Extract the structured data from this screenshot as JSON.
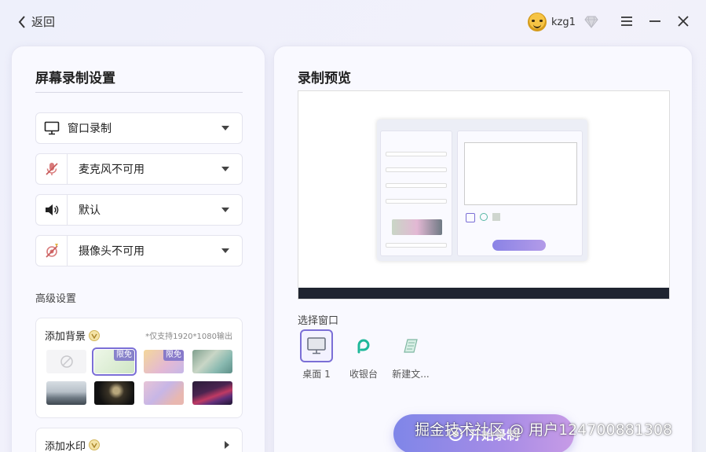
{
  "header": {
    "back_label": "返回",
    "username": "kzg1"
  },
  "left": {
    "title": "屏幕录制设置",
    "selects": [
      {
        "label": "窗口录制",
        "icon": "monitor-icon"
      },
      {
        "label": "麦克风不可用",
        "icon": "mic-off-icon"
      },
      {
        "label": "默认",
        "icon": "speaker-icon"
      },
      {
        "label": "摄像头不可用",
        "icon": "camera-off-icon"
      }
    ],
    "advanced_label": "高级设置",
    "background": {
      "title": "添加背景",
      "note": "*仅支持1920*1080输出",
      "badges": [
        "限免",
        "限免"
      ]
    },
    "watermark_label": "添加水印"
  },
  "right": {
    "title": "录制预览",
    "choose_label": "选择窗口",
    "windows": [
      {
        "label": "桌面 1",
        "icon": "desktop-icon"
      },
      {
        "label": "收银台",
        "icon": "app-icon"
      },
      {
        "label": "新建文...",
        "icon": "notepad-icon"
      }
    ],
    "start_label": "开始录制"
  },
  "overlay": {
    "watermark_text": "掘金技术社区 @ 用户124700881308"
  },
  "colors": {
    "accent": "#7b6fd6",
    "button_gradient_start": "#7f86e8",
    "button_gradient_end": "#c79be6"
  }
}
